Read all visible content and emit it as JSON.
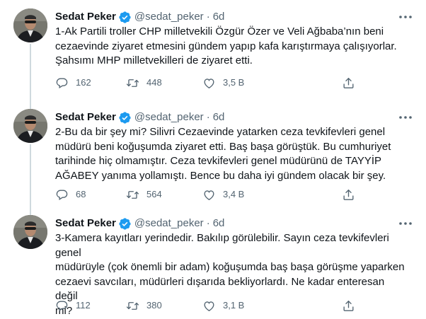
{
  "tweets": [
    {
      "name": "Sedat Peker",
      "handle": "@sedat_peker",
      "separator": "·",
      "time": "6d",
      "text": "1-Ak Partili troller CHP milletvekili Özgür Özer ve Veli Ağbaba’nın beni\ncezaevinde ziyaret etmesini gündem yapıp kafa karıştırmaya çalışıyorlar.\nŞahsımı MHP milletvekilleri de ziyaret etti.",
      "replies": "162",
      "retweets": "448",
      "likes": "3,5 B"
    },
    {
      "name": "Sedat Peker",
      "handle": "@sedat_peker",
      "separator": "·",
      "time": "6d",
      "text": "2-Bu da bir şey mi? Silivri Cezaevinde yatarken ceza tevkifevleri genel\nmüdürü beni koğuşumda ziyaret etti. Baş başa görüştük. Bu cumhuriyet\ntarihinde hiç olmamıştır. Ceza tevkifevleri genel müdürünü de TAYYİP\nAĞABEY yanıma yollamıştı. Bence bu daha iyi gündem olacak bir şey.",
      "replies": "68",
      "retweets": "564",
      "likes": "3,4 B"
    },
    {
      "name": "Sedat Peker",
      "handle": "@sedat_peker",
      "separator": "·",
      "time": "6d",
      "text": "3-Kamera kayıtları yerindedir. Bakılıp görülebilir. Sayın ceza tevkifevleri genel\nmüdürüyle (çok önemli bir adam) koğuşumda baş başa görüşme yaparken\ncezaevi savcıları, müdürleri dışarıda bekliyorlardı. Ne kadar enteresan değil\nmi?",
      "replies": "112",
      "retweets": "380",
      "likes": "3,1 B"
    }
  ],
  "icons": {
    "verified": "verified-badge-icon",
    "more": "more-options-icon",
    "reply": "reply-icon",
    "retweet": "retweet-icon",
    "like": "heart-icon",
    "share": "share-icon"
  },
  "colors": {
    "text": "#0f1419",
    "secondary": "#536471",
    "verified": "#1d9bf0",
    "thread_line": "#cfd9de",
    "avatar_bg": "#6d6e6a"
  }
}
